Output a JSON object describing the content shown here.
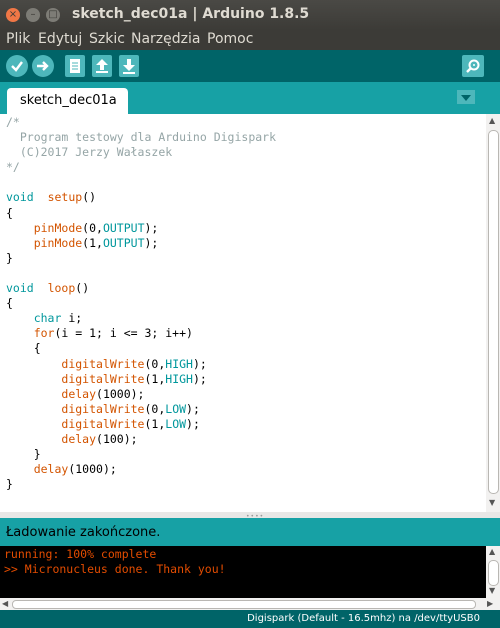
{
  "window": {
    "title": "sketch_dec01a | Arduino 1.8.5",
    "close_glyph": "×",
    "min_glyph": "–",
    "max_glyph": "□"
  },
  "menu": [
    "Plik",
    "Edytuj",
    "Szkic",
    "Narzędzia",
    "Pomoc"
  ],
  "toolbar": {
    "buttons": [
      "verify",
      "upload",
      "new",
      "open",
      "save",
      "serial-monitor"
    ]
  },
  "tab": {
    "label": "sketch_dec01a"
  },
  "code": {
    "lines": [
      [
        [
          "cm",
          "/*"
        ]
      ],
      [
        [
          "cm",
          "  Program testowy dla Arduino Digispark"
        ]
      ],
      [
        [
          "cm",
          "  (C)2017 Jerzy Wałaszek"
        ]
      ],
      [
        [
          "cm",
          "*/"
        ]
      ],
      [],
      [
        [
          "kw",
          "void"
        ],
        [
          "",
          "  "
        ],
        [
          "fn",
          "setup"
        ],
        [
          "",
          "()"
        ]
      ],
      [
        [
          "",
          "{"
        ]
      ],
      [
        [
          "",
          "    "
        ],
        [
          "fn",
          "pinMode"
        ],
        [
          "",
          "(0,"
        ],
        [
          "kw",
          "OUTPUT"
        ],
        [
          "",
          ");"
        ]
      ],
      [
        [
          "",
          "    "
        ],
        [
          "fn",
          "pinMode"
        ],
        [
          "",
          "(1,"
        ],
        [
          "kw",
          "OUTPUT"
        ],
        [
          "",
          ");"
        ]
      ],
      [
        [
          "",
          "}"
        ]
      ],
      [],
      [
        [
          "kw",
          "void"
        ],
        [
          "",
          "  "
        ],
        [
          "fn",
          "loop"
        ],
        [
          "",
          "()"
        ]
      ],
      [
        [
          "",
          "{"
        ]
      ],
      [
        [
          "",
          "    "
        ],
        [
          "kw",
          "char"
        ],
        [
          "",
          " i;"
        ]
      ],
      [
        [
          "",
          "    "
        ],
        [
          "fn",
          "for"
        ],
        [
          "",
          "(i = 1; i <= 3; i++)"
        ]
      ],
      [
        [
          "",
          "    {"
        ]
      ],
      [
        [
          "",
          "        "
        ],
        [
          "fn",
          "digitalWrite"
        ],
        [
          "",
          "(0,"
        ],
        [
          "kw",
          "HIGH"
        ],
        [
          "",
          ");"
        ]
      ],
      [
        [
          "",
          "        "
        ],
        [
          "fn",
          "digitalWrite"
        ],
        [
          "",
          "(1,"
        ],
        [
          "kw",
          "HIGH"
        ],
        [
          "",
          ");"
        ]
      ],
      [
        [
          "",
          "        "
        ],
        [
          "fn",
          "delay"
        ],
        [
          "",
          "(1000);"
        ]
      ],
      [
        [
          "",
          "        "
        ],
        [
          "fn",
          "digitalWrite"
        ],
        [
          "",
          "(0,"
        ],
        [
          "kw",
          "LOW"
        ],
        [
          "",
          ");"
        ]
      ],
      [
        [
          "",
          "        "
        ],
        [
          "fn",
          "digitalWrite"
        ],
        [
          "",
          "(1,"
        ],
        [
          "kw",
          "LOW"
        ],
        [
          "",
          ");"
        ]
      ],
      [
        [
          "",
          "        "
        ],
        [
          "fn",
          "delay"
        ],
        [
          "",
          "(100);"
        ]
      ],
      [
        [
          "",
          "    }"
        ]
      ],
      [
        [
          "",
          "    "
        ],
        [
          "fn",
          "delay"
        ],
        [
          "",
          "(1000);"
        ]
      ],
      [
        [
          "",
          "}"
        ]
      ]
    ]
  },
  "status": {
    "message": "Ładowanie zakończone."
  },
  "console": {
    "lines": [
      "running: 100% complete",
      ">> Micronucleus done. Thank you!"
    ]
  },
  "board": {
    "info": "Digispark (Default - 16.5mhz) na /dev/ttyUSB0"
  },
  "colors": {
    "toolbar": "#006468",
    "accent": "#17a1a5",
    "button": "#4db7bb",
    "keyword": "#00979c",
    "function": "#d35400",
    "comment": "#95a5a6",
    "console_text": "#e34c00"
  }
}
